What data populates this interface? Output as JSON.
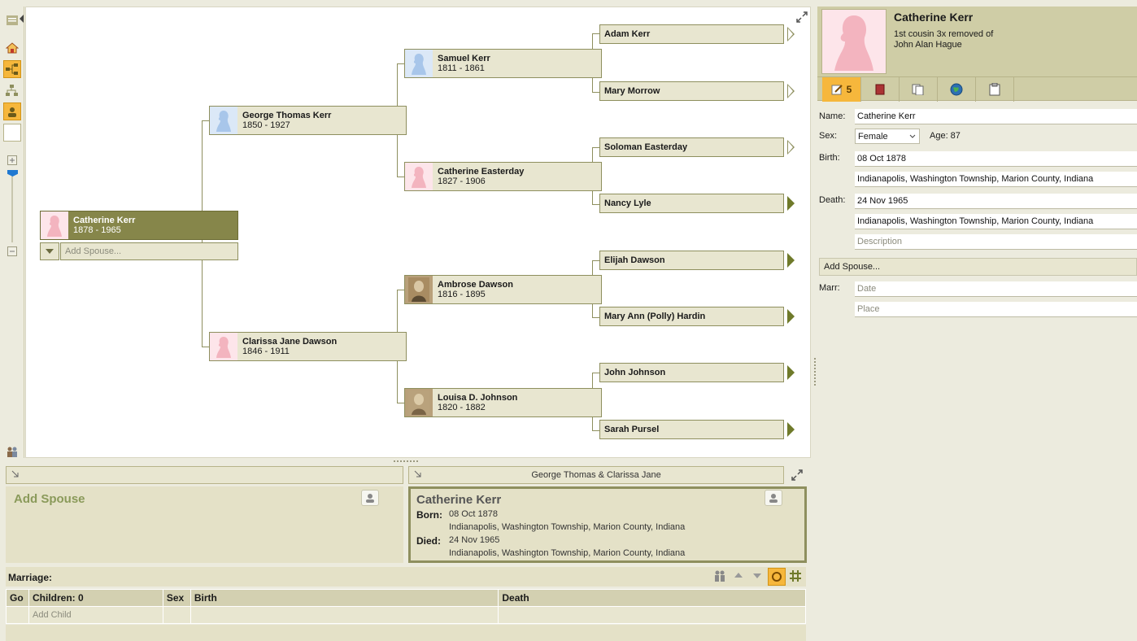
{
  "tree": {
    "root": {
      "name": "Catherine Kerr",
      "dates": "1878 - 1965",
      "add_spouse": "Add Spouse..."
    },
    "parents": [
      {
        "name": "George Thomas Kerr",
        "dates": "1850 - 1927"
      },
      {
        "name": "Clarissa Jane Dawson",
        "dates": "1846 - 1911"
      }
    ],
    "grandparents": [
      {
        "name": "Samuel Kerr",
        "dates": "1811 - 1861"
      },
      {
        "name": "Catherine Easterday",
        "dates": "1827 - 1906"
      },
      {
        "name": "Ambrose Dawson",
        "dates": "1816 - 1895"
      },
      {
        "name": "Louisa D. Johnson",
        "dates": "1820 - 1882"
      }
    ],
    "great_grandparents": [
      {
        "name": "Adam Kerr"
      },
      {
        "name": "Mary Morrow"
      },
      {
        "name": "Soloman Easterday"
      },
      {
        "name": "Nancy Lyle"
      },
      {
        "name": "Elijah Dawson"
      },
      {
        "name": "Mary Ann (Polly) Hardin"
      },
      {
        "name": "John Johnson"
      },
      {
        "name": "Sarah Pursel"
      }
    ]
  },
  "family_panel": {
    "parents_bar": "George Thomas & Clarissa Jane",
    "spouse_card": {
      "title": "Add Spouse"
    },
    "person_card": {
      "name": "Catherine Kerr",
      "born_label": "Born:",
      "born_date": "08 Oct 1878",
      "born_place": "Indianapolis, Washington Township, Marion County, Indiana",
      "died_label": "Died:",
      "died_date": "24 Nov 1965",
      "died_place": "Indianapolis, Washington Township, Marion County, Indiana"
    },
    "marriage_label": "Marriage:",
    "children_table": {
      "headers": [
        "Go",
        "Children: 0",
        "Sex",
        "Birth",
        "Death"
      ],
      "add_child": "Add Child"
    }
  },
  "details": {
    "name": "Catherine Kerr",
    "relationship_line1": "1st cousin 3x removed of",
    "relationship_line2": "John Alan Hague",
    "tabs": {
      "edit_count": "5"
    },
    "labels": {
      "name": "Name:",
      "sex": "Sex:",
      "birth": "Birth:",
      "death": "Death:",
      "marr": "Marr:",
      "age": "Age: 87",
      "add_spouse": "Add Spouse..."
    },
    "fields": {
      "name": "Catherine Kerr",
      "sex": "Female",
      "birth_date": "08 Oct 1878",
      "birth_place": "Indianapolis, Washington Township, Marion County, Indiana",
      "death_date": "24 Nov 1965",
      "death_place": "Indianapolis, Washington Township, Marion County, Indiana",
      "description_placeholder": "Description",
      "marr_date_placeholder": "Date",
      "marr_place_placeholder": "Place"
    }
  },
  "colors": {
    "accent": "#f6b73c",
    "selected_box": "#86864a",
    "box_fill": "#e8e6d0",
    "connector": "#8e8f5e",
    "female_photo": "#fde5ea",
    "male_photo": "#dbe8f7"
  }
}
